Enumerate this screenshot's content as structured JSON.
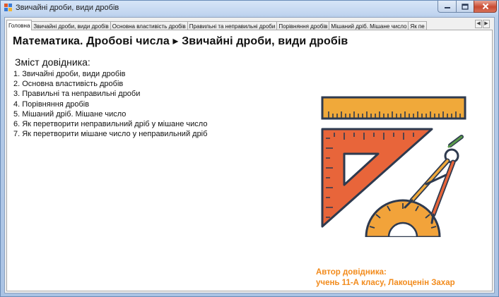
{
  "window": {
    "title": "Звичайні дроби, види дробів"
  },
  "tabs": [
    "Головна",
    "Звичайні дроби, види дробів",
    "Основна властивість дробів",
    "Правильні та неправильні дроби",
    "Порівняння дробів",
    "Мішаний дріб. Мішане число",
    "Як пе"
  ],
  "tab_scroll": {
    "left": "◀",
    "right": "▶"
  },
  "main": {
    "heading": "Математика. Дробові числа ▸ Звичайні дроби, види дробів",
    "toc_title": "Зміст довідника:",
    "toc_items": [
      "1. Звичайні дроби, види дробів",
      "2. Основна властивість дробів",
      "3. Правильні та неправильні дроби",
      "4. Порівняння дробів",
      "5. Мішаний дріб. Мішане число",
      "6. Як перетворити неправильний дріб у мішане число",
      "7. Як перетворити мішане число у неправильний дріб"
    ],
    "author_label": "Автор довідника:",
    "author_name": "учень 11-А класу, Лакоценін Захар"
  },
  "icons": {
    "app": "app-icon",
    "illustration": "geometry-tools-illustration"
  },
  "colors": {
    "author": "#f28b1c",
    "ruler": "#f0a93a",
    "triangle": "#e8653a",
    "protractor": "#f2a33a",
    "outline": "#2e3a4f"
  }
}
